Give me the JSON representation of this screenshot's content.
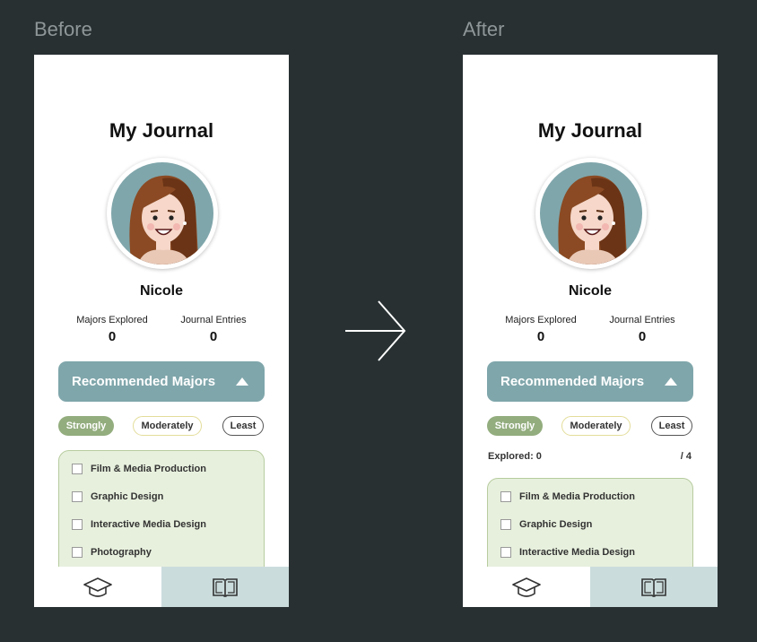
{
  "labels": {
    "before": "Before",
    "after": "After"
  },
  "colors": {
    "background": "#283032",
    "accent": "#7fa6ab",
    "strongly": "#93ad7e",
    "list_bg": "#e7f0dd",
    "nav_active": "#cbdcdd"
  },
  "screens": {
    "before": {
      "title": "My Journal",
      "user_name": "Nicole",
      "stats": [
        {
          "label": "Majors Explored",
          "value": "0"
        },
        {
          "label": "Journal Entries",
          "value": "0"
        }
      ],
      "recommended_button": "Recommended Majors",
      "filters": [
        "Strongly",
        "Moderately",
        "Least"
      ],
      "majors": [
        "Film & Media Production",
        "Graphic Design",
        "Interactive Media Design",
        "Photography"
      ],
      "nav": [
        "graduation-cap-icon",
        "book-icon"
      ]
    },
    "after": {
      "title": "My Journal",
      "user_name": "Nicole",
      "stats": [
        {
          "label": "Majors Explored",
          "value": "0"
        },
        {
          "label": "Journal Entries",
          "value": "0"
        }
      ],
      "recommended_button": "Recommended Majors",
      "filters": [
        "Strongly",
        "Moderately",
        "Least"
      ],
      "explored_label": "Explored: 0",
      "explored_total": "/ 4",
      "majors": [
        "Film & Media Production",
        "Graphic Design",
        "Interactive Media Design"
      ],
      "nav": [
        "graduation-cap-icon",
        "book-icon"
      ]
    }
  }
}
